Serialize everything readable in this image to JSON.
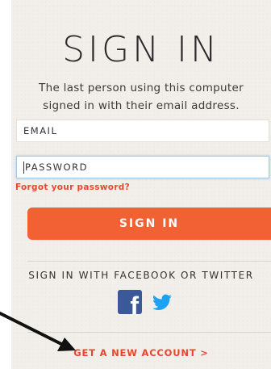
{
  "header": {
    "title": "SIGN IN",
    "subtitle_line1": "The last person using this computer",
    "subtitle_line2": "signed in with their email address."
  },
  "form": {
    "email_placeholder": "EMAIL",
    "password_placeholder": "PASSWORD",
    "forgot_link": "Forgot your password?",
    "submit_label": "SIGN IN"
  },
  "social": {
    "label": "SIGN IN WITH FACEBOOK OR TWITTER",
    "facebook_icon": "facebook-icon",
    "twitter_icon": "twitter-icon"
  },
  "footer": {
    "new_account_link": "GET A NEW ACCOUNT >"
  },
  "colors": {
    "accent": "#f26133",
    "link": "#e8472d",
    "facebook": "#3b5998",
    "twitter": "#1da1f2",
    "panel": "#f2efea"
  }
}
